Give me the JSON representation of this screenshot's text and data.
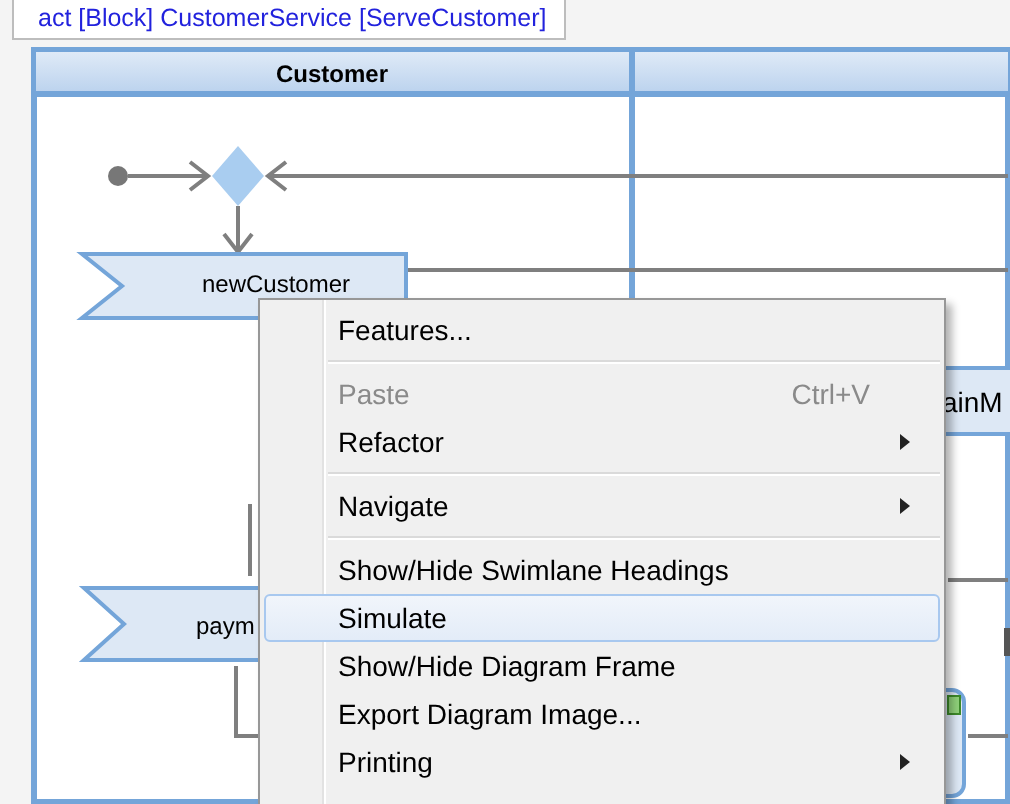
{
  "diagram": {
    "frame_title": "act [Block] CustomerService [ServeCustomer]",
    "lanes": [
      {
        "label": "Customer"
      }
    ],
    "nodes": [
      {
        "label": "newCustomer"
      },
      {
        "label": "ainM"
      },
      {
        "label": "paym"
      }
    ]
  },
  "context_menu": {
    "items": [
      {
        "kind": "item",
        "label": "Features...",
        "disabled": false,
        "selected": false,
        "submenu": false
      },
      {
        "kind": "separator"
      },
      {
        "kind": "item",
        "label": "Paste",
        "shortcut": "Ctrl+V",
        "disabled": true,
        "selected": false,
        "submenu": false
      },
      {
        "kind": "item",
        "label": "Refactor",
        "disabled": false,
        "selected": false,
        "submenu": true
      },
      {
        "kind": "separator"
      },
      {
        "kind": "item",
        "label": "Navigate",
        "disabled": false,
        "selected": false,
        "submenu": true
      },
      {
        "kind": "separator"
      },
      {
        "kind": "item",
        "label": "Show/Hide Swimlane Headings",
        "disabled": false,
        "selected": false,
        "submenu": false
      },
      {
        "kind": "item",
        "label": "Simulate",
        "disabled": false,
        "selected": true,
        "submenu": false
      },
      {
        "kind": "item",
        "label": "Show/Hide Diagram Frame",
        "disabled": false,
        "selected": false,
        "submenu": false
      },
      {
        "kind": "item",
        "label": "Export Diagram Image...",
        "disabled": false,
        "selected": false,
        "submenu": false
      },
      {
        "kind": "item",
        "label": "Printing",
        "disabled": false,
        "selected": false,
        "submenu": true
      }
    ]
  }
}
